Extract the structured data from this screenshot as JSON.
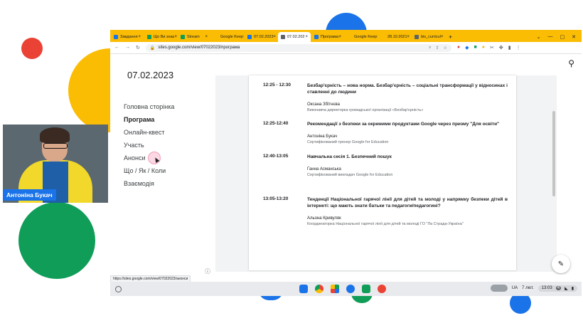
{
  "colors": {
    "yellow": "#fbbc04",
    "blue": "#1a73e8",
    "green": "#0f9d58",
    "red": "#ea4335"
  },
  "browser": {
    "tabs": [
      {
        "label": "Завдання",
        "fav": "#1a73e8"
      },
      {
        "label": "Що Ви знає",
        "fav": "#0f9d58"
      },
      {
        "label": "Stream",
        "fav": "#0f9d58"
      },
      {
        "label": "Google Keep",
        "fav": "#fbbc04"
      },
      {
        "label": "07.02.2023",
        "fav": "#1a73e8"
      },
      {
        "label": "07.02.202",
        "fav": "#5f6368",
        "active": true
      },
      {
        "label": "Програма",
        "fav": "#1a73e8"
      },
      {
        "label": "Google Keep",
        "fav": "#fbbc04"
      },
      {
        "label": "28.10.2021",
        "fav": "#fbbc04"
      },
      {
        "label": "bis_curricul",
        "fav": "#5f6368"
      }
    ],
    "url": "sites.google.com/view/07022023/програма",
    "status_url": "https://sites.google.com/view/07022023/анонси"
  },
  "site": {
    "title": "07.02.2023",
    "nav": [
      {
        "label": "Головна сторінка"
      },
      {
        "label": "Програма",
        "active": true
      },
      {
        "label": "Онлайн-квест"
      },
      {
        "label": "Участь"
      },
      {
        "label": "Анонси"
      },
      {
        "label": "Що / Як / Коли"
      },
      {
        "label": "Взаємодія"
      }
    ]
  },
  "schedule": [
    {
      "time": "12:25 - 12:30",
      "title": "Безбар'єрність – нова норма. Безбар'єрність – соціальні трансформації у відносинах і ставленні до людини",
      "speaker": "Оксана Збітнєва",
      "role": "Виконавча директорка громадської організації «Безбар'єрність»"
    },
    {
      "time": "12:25-12:40",
      "title": "Рекомендації з безпеки за окремими продуктами Google через призму \"Для освіти\"",
      "speaker": "Антоніна Букач",
      "role": "Сертифікований тренер Google for Education"
    },
    {
      "time": "12:40-13:05",
      "title": "Навчальна сесія 1. Безпечний пошук",
      "speaker": "Ганна Асманська",
      "role": "Сертифікований викладач Google for Education"
    },
    {
      "time": "13:05-13:20",
      "title": "Тенденції Національної гарячої лінії для дітей та молоді у напрямку безпеки дітей в інтернеті: що мають знати батьки та педагоги/педагогині?",
      "speaker": "Альона Кривуляк",
      "role": "Координаторка Національної гарячої лінії для дітей та молоді ГО \"Ла Страда-Україна\""
    }
  ],
  "video": {
    "name": "Антоніна Букач"
  },
  "shelf": {
    "lang": "UA",
    "date": "7 лют.",
    "time": "13:03",
    "badge": "4"
  }
}
